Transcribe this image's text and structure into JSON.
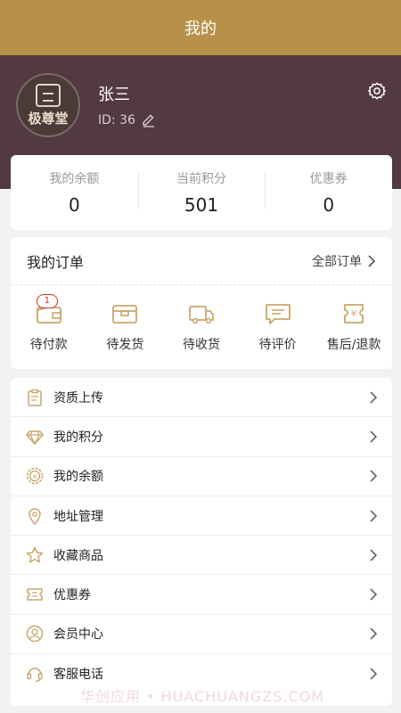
{
  "header": {
    "title": "我的"
  },
  "profile": {
    "avatar_text": "极尊堂",
    "name": "张三",
    "id_text": "ID: 36"
  },
  "stats": [
    {
      "label": "我的余额",
      "value": "0"
    },
    {
      "label": "当前积分",
      "value": "501"
    },
    {
      "label": "优惠券",
      "value": "0"
    }
  ],
  "orders": {
    "title": "我的订单",
    "all_label": "全部订单",
    "items": [
      {
        "label": "待付款",
        "badge": "1",
        "icon": "wallet-icon"
      },
      {
        "label": "待发货",
        "icon": "box-icon"
      },
      {
        "label": "待收货",
        "icon": "truck-icon"
      },
      {
        "label": "待评价",
        "icon": "comment-icon"
      },
      {
        "label": "售后/退款",
        "icon": "refund-icon"
      }
    ]
  },
  "menu": [
    {
      "label": "资质上传",
      "icon": "clipboard-icon"
    },
    {
      "label": "我的积分",
      "icon": "diamond-icon"
    },
    {
      "label": "我的余额",
      "icon": "coin-icon"
    },
    {
      "label": "地址管理",
      "icon": "location-icon"
    },
    {
      "label": "收藏商品",
      "icon": "star-icon"
    },
    {
      "label": "优惠券",
      "icon": "ticket-icon"
    },
    {
      "label": "会员中心",
      "icon": "user-icon"
    },
    {
      "label": "客服电话",
      "icon": "headset-icon"
    }
  ],
  "watermark": "华创应用 • HUACHUANGZS.COM",
  "colors": {
    "accent": "#b8904a",
    "profile_bg": "#523942",
    "badge": "#d0342c",
    "icon": "#c9a66b"
  }
}
